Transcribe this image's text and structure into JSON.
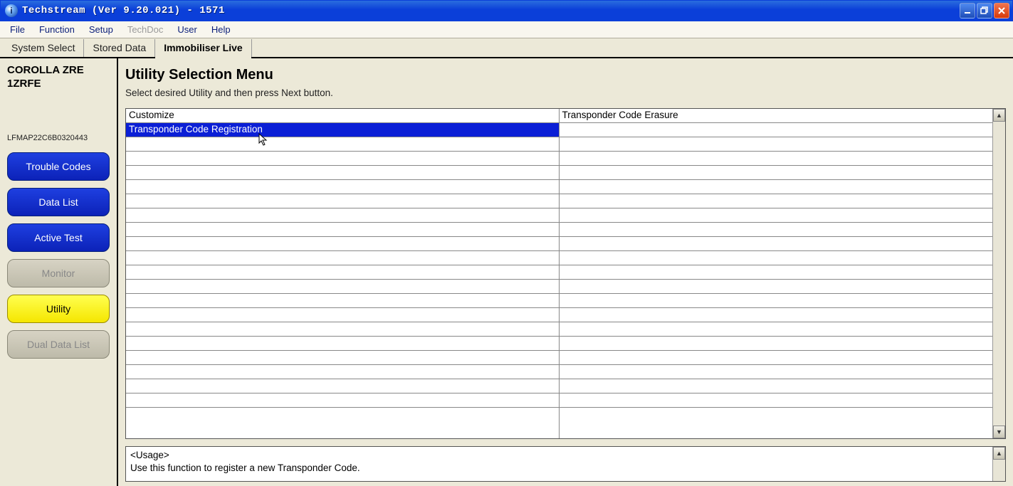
{
  "titlebar": {
    "app_icon_letter": "i",
    "title": "Techstream (Ver 9.20.021) - 1571"
  },
  "menubar": {
    "items": [
      {
        "label": "File",
        "disabled": false
      },
      {
        "label": "Function",
        "disabled": false
      },
      {
        "label": "Setup",
        "disabled": false
      },
      {
        "label": "TechDoc",
        "disabled": true
      },
      {
        "label": "User",
        "disabled": false
      },
      {
        "label": "Help",
        "disabled": false
      }
    ]
  },
  "tabs": {
    "items": [
      {
        "label": "System Select",
        "active": false
      },
      {
        "label": "Stored Data",
        "active": false
      },
      {
        "label": "Immobiliser Live",
        "active": true
      }
    ]
  },
  "sidebar": {
    "vehicle_line1": "COROLLA ZRE",
    "vehicle_line2": "1ZRFE",
    "vin": "LFMAP22C6B0320443",
    "buttons": [
      {
        "label": "Trouble Codes",
        "style": "blue",
        "interactable": true
      },
      {
        "label": "Data List",
        "style": "blue",
        "interactable": true
      },
      {
        "label": "Active Test",
        "style": "blue",
        "interactable": true
      },
      {
        "label": "Monitor",
        "style": "grey",
        "interactable": false
      },
      {
        "label": "Utility",
        "style": "yellow",
        "interactable": true
      },
      {
        "label": "Dual Data List",
        "style": "grey",
        "interactable": false
      }
    ]
  },
  "main": {
    "title": "Utility Selection Menu",
    "subtitle": "Select desired Utility and then press Next button.",
    "grid": {
      "rows_per_column": 21,
      "col0": [
        {
          "text": "Customize",
          "selected": false
        },
        {
          "text": "Transponder Code Registration",
          "selected": true
        }
      ],
      "col1": [
        {
          "text": "Transponder Code Erasure",
          "selected": false
        }
      ]
    },
    "usage": {
      "line1": "<Usage>",
      "line2": "Use this function to register a new Transponder Code."
    }
  }
}
